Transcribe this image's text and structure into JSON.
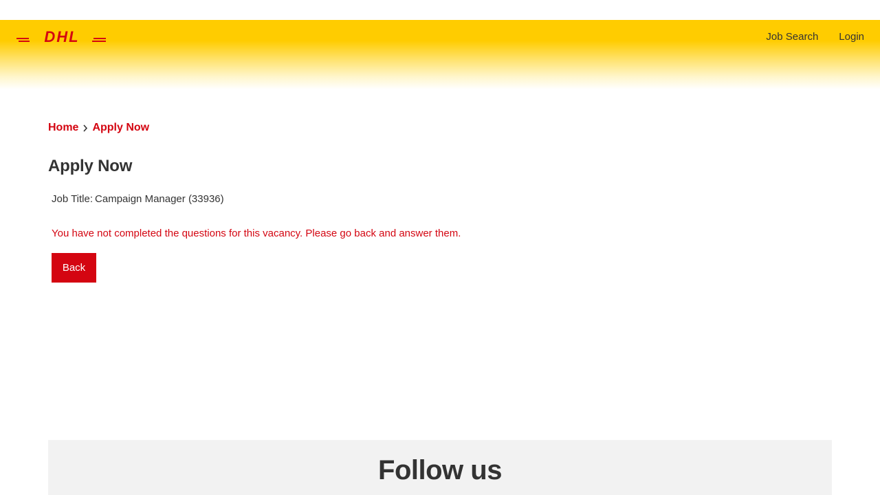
{
  "header": {
    "logo_text": "DHL",
    "nav": [
      {
        "label": "Job Search"
      },
      {
        "label": "Login"
      }
    ]
  },
  "breadcrumb": {
    "items": [
      {
        "label": "Home"
      },
      {
        "label": "Apply Now"
      }
    ],
    "separator_icon": "chevron-right-icon"
  },
  "main": {
    "title": "Apply Now",
    "job_title_label": "Job Title:",
    "job_title_value": "Campaign Manager (33936)",
    "error_message": "You have not completed the questions for this vacancy. Please go back and answer them.",
    "back_label": "Back"
  },
  "footer": {
    "follow_title": "Follow us"
  },
  "colors": {
    "brand_yellow": "#ffcc00",
    "brand_red": "#d40511",
    "text_dark": "#333333",
    "footer_bg": "#f2f2f2"
  }
}
